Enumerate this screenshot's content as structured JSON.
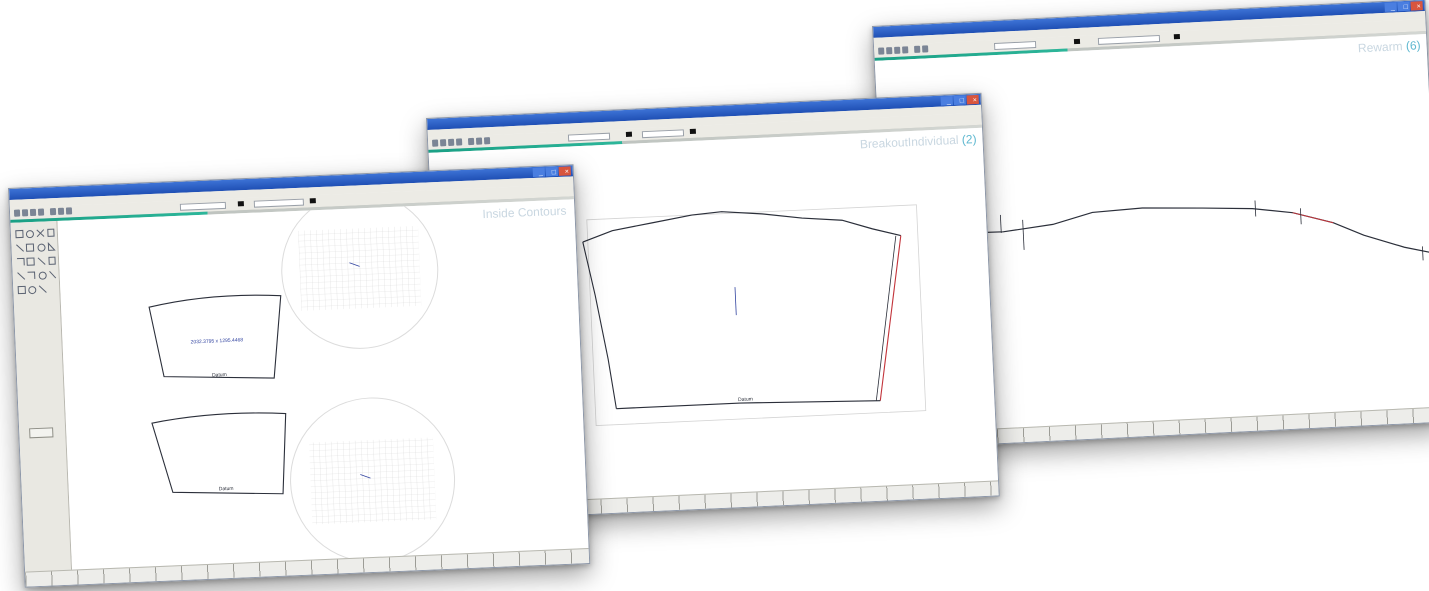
{
  "windows": {
    "right": {
      "view_label": "Rewarm",
      "view_number": "(6)",
      "window_buttons": [
        "_",
        "□",
        "×"
      ]
    },
    "middle": {
      "view_label": "BreakoutIndividual",
      "view_number": "(2)",
      "window_buttons": [
        "_",
        "□",
        "×"
      ],
      "footer_label": "Datum"
    },
    "left": {
      "view_label": "Inside Contours",
      "window_buttons": [
        "_",
        "□",
        "×"
      ],
      "top_shape_text": "2032.3795 x 1295.4468",
      "top_shape_footer": "Datum",
      "bottom_shape_footer": "Datum"
    }
  },
  "colors": {
    "titlebar": "#2a5fc8",
    "accent_teal": "#1aa085",
    "view_label": "#c9d7e1",
    "view_number": "#5fb8d0",
    "profile_line": "#2b2f3a",
    "profile_red": "#c2333a",
    "annotation_blue": "#3244a0"
  }
}
